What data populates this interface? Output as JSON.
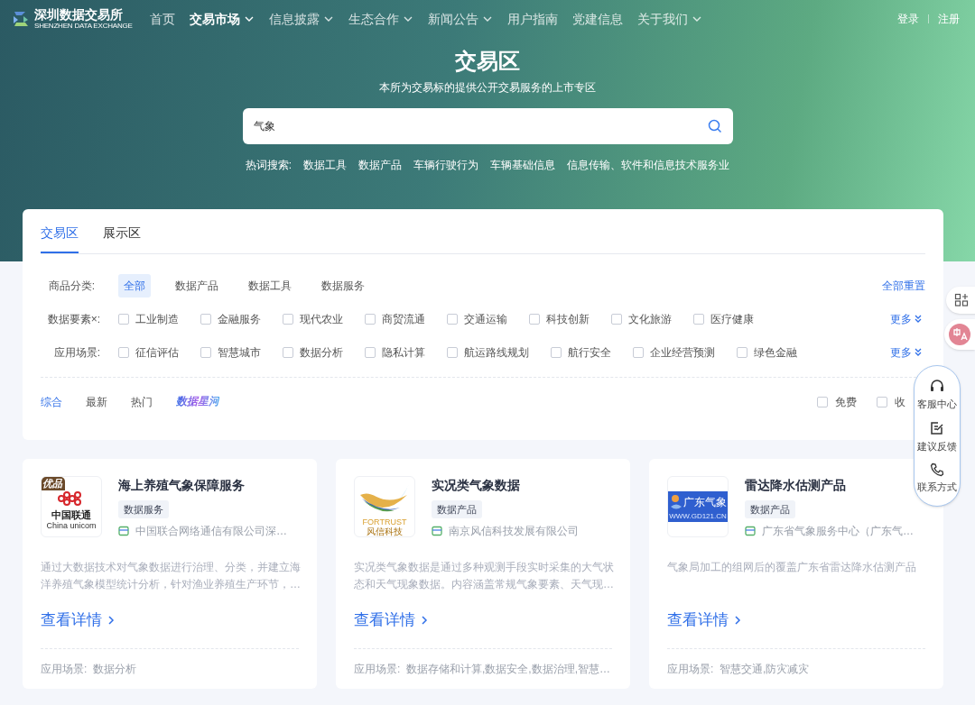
{
  "header": {
    "logo": {
      "name": "深圳数据交易所",
      "subtitle": "SHENZHEN DATA EXCHANGE"
    },
    "nav": [
      {
        "label": "首页",
        "selected": false,
        "dropdown": false
      },
      {
        "label": "交易市场",
        "selected": true,
        "dropdown": true
      },
      {
        "label": "信息披露",
        "selected": false,
        "dropdown": true
      },
      {
        "label": "生态合作",
        "selected": false,
        "dropdown": true
      },
      {
        "label": "新闻公告",
        "selected": false,
        "dropdown": true
      },
      {
        "label": "用户指南",
        "selected": false,
        "dropdown": false
      },
      {
        "label": "党建信息",
        "selected": false,
        "dropdown": false
      },
      {
        "label": "关于我们",
        "selected": false,
        "dropdown": true
      }
    ],
    "account": [
      "登录",
      "注册"
    ]
  },
  "hero": {
    "title": "交易区",
    "subtitle": "本所为交易标的提供公开交易服务的上市专区",
    "search": {
      "value": "气象"
    },
    "hot_label": "热词搜索:",
    "hot_words": [
      "数据工具",
      "数据产品",
      "车辆行驶行为",
      "车辆基础信息",
      "信息传输、软件和信息技术服务业"
    ]
  },
  "tabs": [
    {
      "label": "交易区",
      "selected": true
    },
    {
      "label": "展示区",
      "selected": false
    }
  ],
  "filters": {
    "reset": "全部重置",
    "category": {
      "label": "商品分类:",
      "options": [
        {
          "label": "全部",
          "selected": true
        },
        {
          "label": "数据产品",
          "selected": false
        },
        {
          "label": "数据工具",
          "selected": false
        },
        {
          "label": "数据服务",
          "selected": false
        }
      ]
    },
    "rows": [
      {
        "label": "数据要素×:",
        "more": "更多",
        "options": [
          {
            "label": "工业制造",
            "checked": false
          },
          {
            "label": "金融服务",
            "checked": false
          },
          {
            "label": "现代农业",
            "checked": false
          },
          {
            "label": "商贸流通",
            "checked": false
          },
          {
            "label": "交通运输",
            "checked": false
          },
          {
            "label": "科技创新",
            "checked": false
          },
          {
            "label": "文化旅游",
            "checked": false
          },
          {
            "label": "医疗健康",
            "checked": false
          }
        ]
      },
      {
        "label": "应用场景:",
        "more": "更多",
        "options": [
          {
            "label": "征信评估",
            "checked": false
          },
          {
            "label": "智慧城市",
            "checked": false
          },
          {
            "label": "数据分析",
            "checked": false
          },
          {
            "label": "隐私计算",
            "checked": false
          },
          {
            "label": "航运路线规划",
            "checked": false
          },
          {
            "label": "航行安全",
            "checked": false
          },
          {
            "label": "企业经营预测",
            "checked": false
          },
          {
            "label": "绿色金融",
            "checked": false
          }
        ]
      }
    ]
  },
  "sort": [
    {
      "label": "综合",
      "selected": true,
      "kind": "plain"
    },
    {
      "label": "最新",
      "selected": false,
      "kind": "plain"
    },
    {
      "label": "热门",
      "selected": false,
      "kind": "plain"
    },
    {
      "label": "数据星河",
      "selected": false,
      "kind": "brand"
    }
  ],
  "price_filters": [
    {
      "label": "免费",
      "checked": false
    },
    {
      "label": "收",
      "checked": false
    }
  ],
  "products": [
    {
      "title": "海上养殖气象保障服务",
      "badge": "优品",
      "logo": {
        "kind": "unicom",
        "texts": [
          "中国联通",
          "China unicom"
        ]
      },
      "tag": "数据服务",
      "company": "中国联合网络通信有限公司深…",
      "description": "通过大数据技术对气象数据进行治理、分类，并建立海洋养殖气象模型统计分析，针对渔业养殖生产环节，…",
      "link": "查看详情",
      "scenes": "应用场景:  数据分析"
    },
    {
      "title": "实况类气象数据",
      "logo": {
        "kind": "feather",
        "texts": [
          "FORTRUST",
          "风信科技"
        ]
      },
      "tag": "数据产品",
      "company": "南京风信科技发展有限公司",
      "description": "实况类气象数据是通过多种观测手段实时采集的大气状态和天气现象数据。内容涵盖常规气象要素、天气现…",
      "link": "查看详情",
      "scenes": "应用场景:  数据存储和计算,数据安全,数据治理,智慧…"
    },
    {
      "title": "雷达降水估测产品",
      "logo": {
        "kind": "weather",
        "texts": [
          "广东气象",
          "WWW.GD121.CN"
        ]
      },
      "tag": "数据产品",
      "company": "广东省气象服务中心（广东气…",
      "description": "气象局加工的组网后的覆盖广东省雷达降水估测产品",
      "link": "查看详情",
      "scenes": "应用场景:  智慧交通,防灾减灾"
    }
  ],
  "float_menu": [
    "客服中心",
    "建议反馈",
    "联系方式"
  ]
}
